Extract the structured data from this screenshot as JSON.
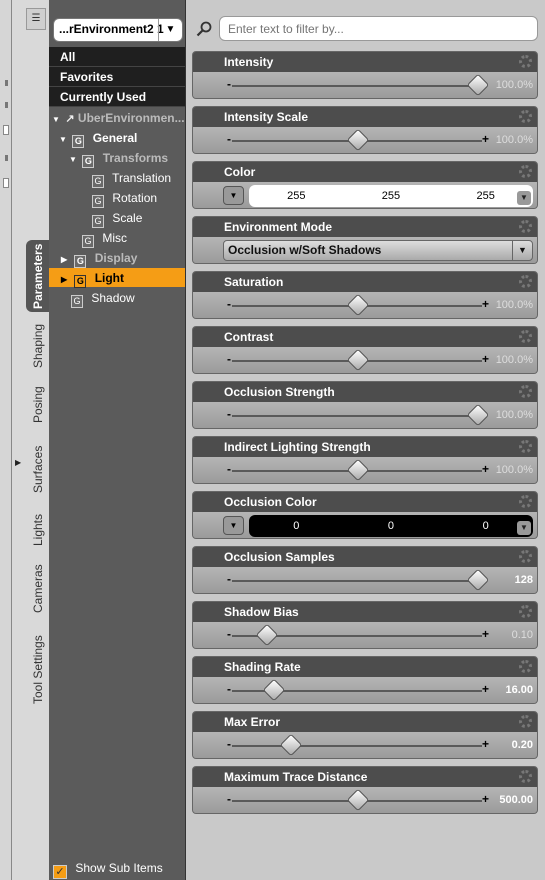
{
  "tabs": [
    {
      "label": "Parameters",
      "active": true
    },
    {
      "label": "Shaping"
    },
    {
      "label": "Posing"
    },
    {
      "label": "Surfaces"
    },
    {
      "label": "Lights"
    },
    {
      "label": "Cameras"
    },
    {
      "label": "Tool Settings"
    }
  ],
  "tree": {
    "node_select": "...rEnvironment2 1",
    "groups": [
      "All",
      "Favorites",
      "Currently Used"
    ],
    "root": "UberEnvironmen...",
    "general": "General",
    "transforms": "Transforms",
    "translation": "Translation",
    "rotation": "Rotation",
    "scale": "Scale",
    "misc": "Misc",
    "display": "Display",
    "light": "Light",
    "shadow": "Shadow",
    "show_sub": "Show Sub Items",
    "group_icon": "G"
  },
  "filter": {
    "placeholder": "Enter text to filter by..."
  },
  "params": [
    {
      "label": "Intensity",
      "type": "slider",
      "value": "100.0%",
      "knob": 1.0,
      "muted": true
    },
    {
      "label": "Intensity Scale",
      "type": "slider",
      "value": "100.0%",
      "knob": 0.5,
      "muted": true,
      "plus": true
    },
    {
      "label": "Color",
      "type": "color",
      "r": "255",
      "g": "255",
      "b": "255",
      "color": "#ffffff"
    },
    {
      "label": "Environment Mode",
      "type": "combo",
      "value": "Occlusion w/Soft Shadows"
    },
    {
      "label": "Saturation",
      "type": "slider",
      "value": "100.0%",
      "knob": 0.5,
      "muted": true,
      "plus": true
    },
    {
      "label": "Contrast",
      "type": "slider",
      "value": "100.0%",
      "knob": 0.5,
      "muted": true,
      "plus": true
    },
    {
      "label": "Occlusion Strength",
      "type": "slider",
      "value": "100.0%",
      "knob": 1.0,
      "muted": true
    },
    {
      "label": "Indirect Lighting Strength",
      "type": "slider",
      "value": "100.0%",
      "knob": 0.5,
      "muted": true,
      "plus": true
    },
    {
      "label": "Occlusion Color",
      "type": "color",
      "r": "0",
      "g": "0",
      "b": "0",
      "color": "#000000"
    },
    {
      "label": "Occlusion Samples",
      "type": "slider",
      "value": "128",
      "knob": 1.0,
      "bold": true
    },
    {
      "label": "Shadow Bias",
      "type": "slider",
      "value": "0.10",
      "knob": 0.12,
      "muted": true,
      "plus": true
    },
    {
      "label": "Shading Rate",
      "type": "slider",
      "value": "16.00",
      "knob": 0.15,
      "bold": true,
      "plus": true
    },
    {
      "label": "Max Error",
      "type": "slider",
      "value": "0.20",
      "knob": 0.22,
      "bold": true,
      "plus": true
    },
    {
      "label": "Maximum Trace Distance",
      "type": "slider",
      "value": "500.00",
      "knob": 0.5,
      "bold": true,
      "plus": true
    }
  ],
  "colors": {
    "accent": "#f59d15",
    "header": "#4d4d4d",
    "tree_bg": "#5b5b5b"
  }
}
